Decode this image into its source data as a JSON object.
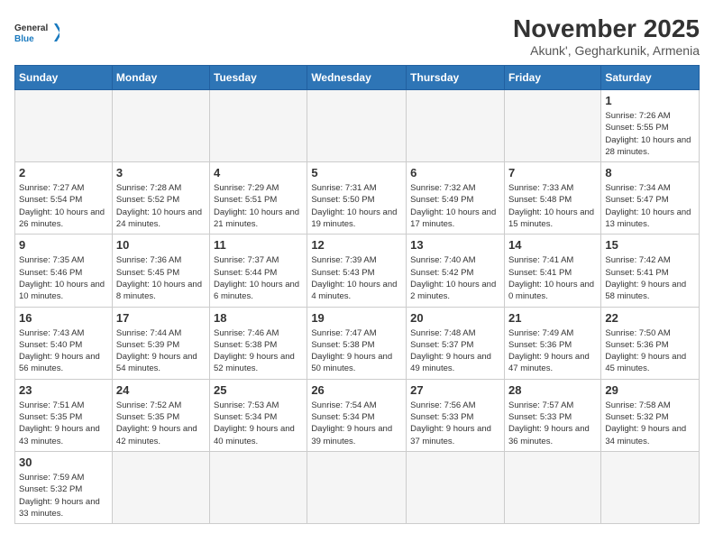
{
  "header": {
    "logo_general": "General",
    "logo_blue": "Blue",
    "month": "November 2025",
    "location": "Akunk', Gegharkunik, Armenia"
  },
  "weekdays": [
    "Sunday",
    "Monday",
    "Tuesday",
    "Wednesday",
    "Thursday",
    "Friday",
    "Saturday"
  ],
  "days": {
    "d1": {
      "num": "1",
      "sunrise": "7:26 AM",
      "sunset": "5:55 PM",
      "daylight": "10 hours and 28 minutes."
    },
    "d2": {
      "num": "2",
      "sunrise": "7:27 AM",
      "sunset": "5:54 PM",
      "daylight": "10 hours and 26 minutes."
    },
    "d3": {
      "num": "3",
      "sunrise": "7:28 AM",
      "sunset": "5:52 PM",
      "daylight": "10 hours and 24 minutes."
    },
    "d4": {
      "num": "4",
      "sunrise": "7:29 AM",
      "sunset": "5:51 PM",
      "daylight": "10 hours and 21 minutes."
    },
    "d5": {
      "num": "5",
      "sunrise": "7:31 AM",
      "sunset": "5:50 PM",
      "daylight": "10 hours and 19 minutes."
    },
    "d6": {
      "num": "6",
      "sunrise": "7:32 AM",
      "sunset": "5:49 PM",
      "daylight": "10 hours and 17 minutes."
    },
    "d7": {
      "num": "7",
      "sunrise": "7:33 AM",
      "sunset": "5:48 PM",
      "daylight": "10 hours and 15 minutes."
    },
    "d8": {
      "num": "8",
      "sunrise": "7:34 AM",
      "sunset": "5:47 PM",
      "daylight": "10 hours and 13 minutes."
    },
    "d9": {
      "num": "9",
      "sunrise": "7:35 AM",
      "sunset": "5:46 PM",
      "daylight": "10 hours and 10 minutes."
    },
    "d10": {
      "num": "10",
      "sunrise": "7:36 AM",
      "sunset": "5:45 PM",
      "daylight": "10 hours and 8 minutes."
    },
    "d11": {
      "num": "11",
      "sunrise": "7:37 AM",
      "sunset": "5:44 PM",
      "daylight": "10 hours and 6 minutes."
    },
    "d12": {
      "num": "12",
      "sunrise": "7:39 AM",
      "sunset": "5:43 PM",
      "daylight": "10 hours and 4 minutes."
    },
    "d13": {
      "num": "13",
      "sunrise": "7:40 AM",
      "sunset": "5:42 PM",
      "daylight": "10 hours and 2 minutes."
    },
    "d14": {
      "num": "14",
      "sunrise": "7:41 AM",
      "sunset": "5:41 PM",
      "daylight": "10 hours and 0 minutes."
    },
    "d15": {
      "num": "15",
      "sunrise": "7:42 AM",
      "sunset": "5:41 PM",
      "daylight": "9 hours and 58 minutes."
    },
    "d16": {
      "num": "16",
      "sunrise": "7:43 AM",
      "sunset": "5:40 PM",
      "daylight": "9 hours and 56 minutes."
    },
    "d17": {
      "num": "17",
      "sunrise": "7:44 AM",
      "sunset": "5:39 PM",
      "daylight": "9 hours and 54 minutes."
    },
    "d18": {
      "num": "18",
      "sunrise": "7:46 AM",
      "sunset": "5:38 PM",
      "daylight": "9 hours and 52 minutes."
    },
    "d19": {
      "num": "19",
      "sunrise": "7:47 AM",
      "sunset": "5:38 PM",
      "daylight": "9 hours and 50 minutes."
    },
    "d20": {
      "num": "20",
      "sunrise": "7:48 AM",
      "sunset": "5:37 PM",
      "daylight": "9 hours and 49 minutes."
    },
    "d21": {
      "num": "21",
      "sunrise": "7:49 AM",
      "sunset": "5:36 PM",
      "daylight": "9 hours and 47 minutes."
    },
    "d22": {
      "num": "22",
      "sunrise": "7:50 AM",
      "sunset": "5:36 PM",
      "daylight": "9 hours and 45 minutes."
    },
    "d23": {
      "num": "23",
      "sunrise": "7:51 AM",
      "sunset": "5:35 PM",
      "daylight": "9 hours and 43 minutes."
    },
    "d24": {
      "num": "24",
      "sunrise": "7:52 AM",
      "sunset": "5:35 PM",
      "daylight": "9 hours and 42 minutes."
    },
    "d25": {
      "num": "25",
      "sunrise": "7:53 AM",
      "sunset": "5:34 PM",
      "daylight": "9 hours and 40 minutes."
    },
    "d26": {
      "num": "26",
      "sunrise": "7:54 AM",
      "sunset": "5:34 PM",
      "daylight": "9 hours and 39 minutes."
    },
    "d27": {
      "num": "27",
      "sunrise": "7:56 AM",
      "sunset": "5:33 PM",
      "daylight": "9 hours and 37 minutes."
    },
    "d28": {
      "num": "28",
      "sunrise": "7:57 AM",
      "sunset": "5:33 PM",
      "daylight": "9 hours and 36 minutes."
    },
    "d29": {
      "num": "29",
      "sunrise": "7:58 AM",
      "sunset": "5:32 PM",
      "daylight": "9 hours and 34 minutes."
    },
    "d30": {
      "num": "30",
      "sunrise": "7:59 AM",
      "sunset": "5:32 PM",
      "daylight": "9 hours and 33 minutes."
    }
  }
}
